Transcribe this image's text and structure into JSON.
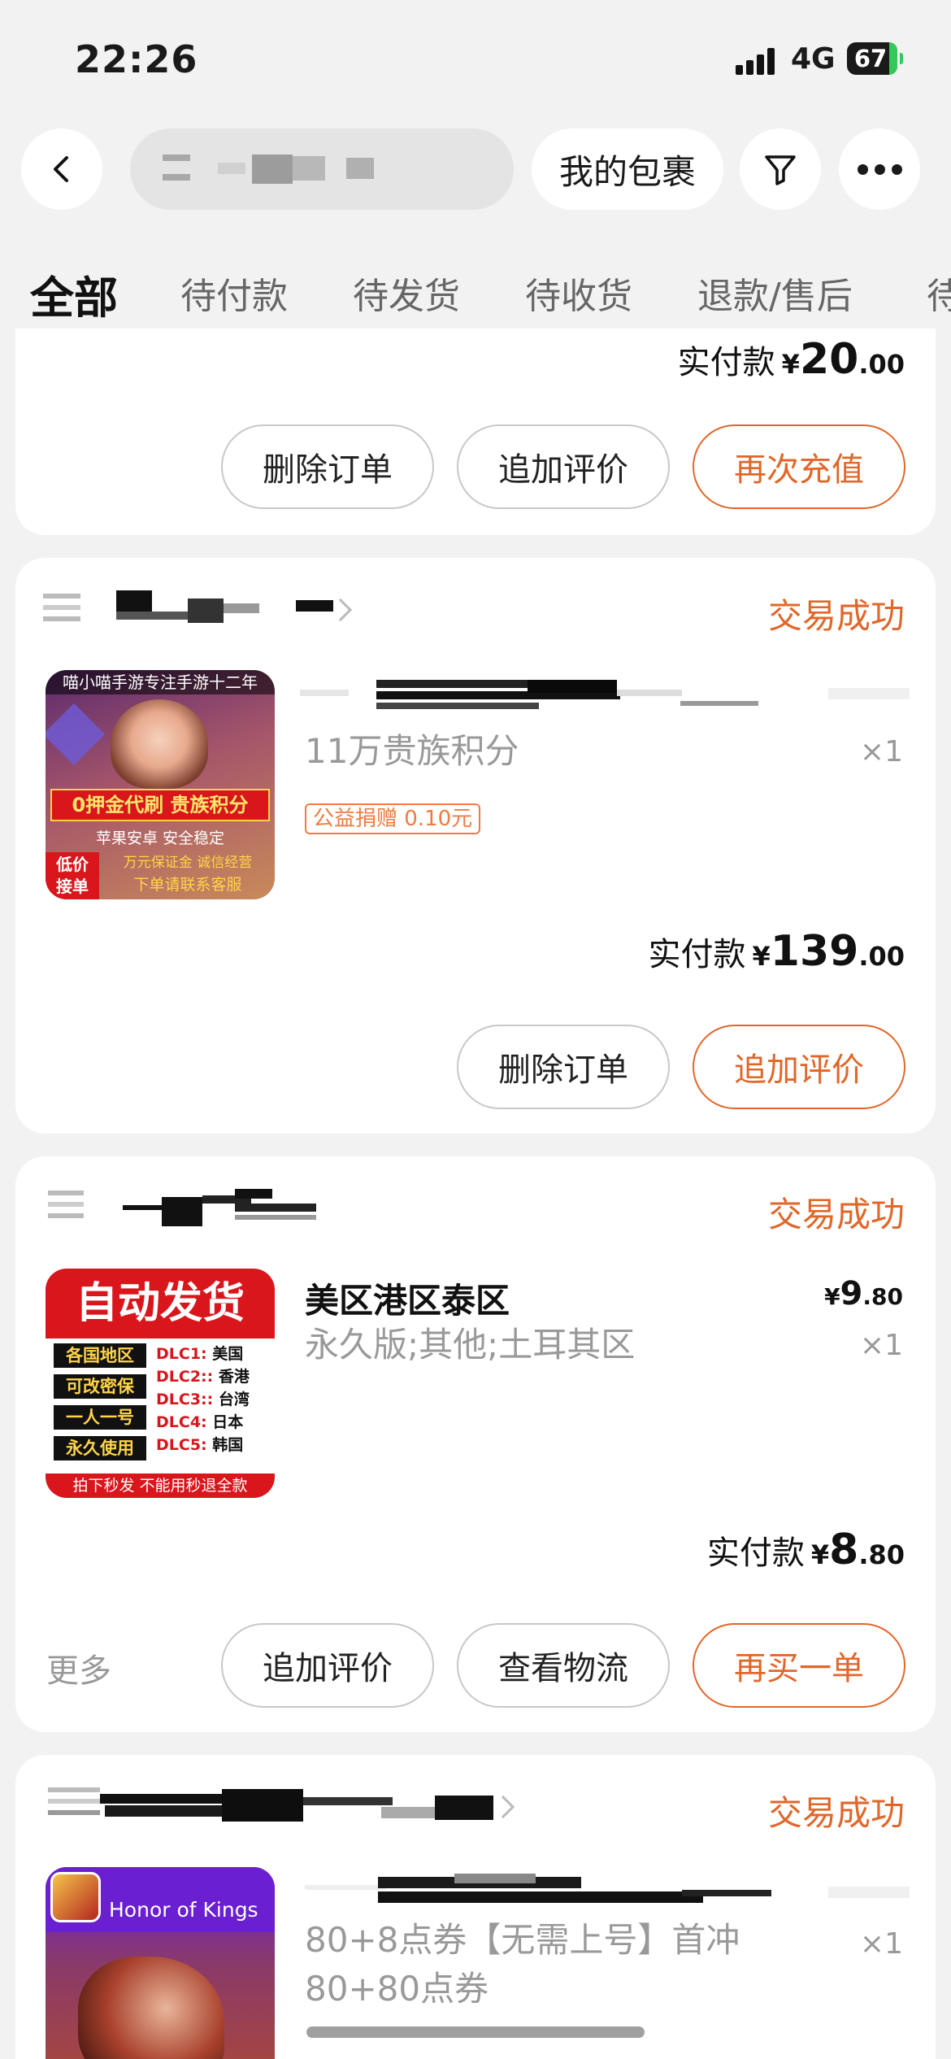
{
  "status_bar": {
    "time": "22:26",
    "network": "4G",
    "battery": "67"
  },
  "nav": {
    "package_label": "我的包裹"
  },
  "tabs": [
    {
      "label": "全部",
      "active": true
    },
    {
      "label": "待付款"
    },
    {
      "label": "待发货"
    },
    {
      "label": "待收货"
    },
    {
      "label": "退款/售后"
    },
    {
      "label": "待"
    }
  ],
  "orders": [
    {
      "paid_label": "实付款",
      "currency": "¥",
      "paid_int": "20",
      "paid_dec": ".00",
      "buttons": [
        "删除订单",
        "追加评价",
        "再次充值"
      ]
    },
    {
      "status": "交易成功",
      "thumb": {
        "banner": "喵小喵手游专注手游十二年",
        "slogan": "0押金代刷 贵族积分",
        "sub": "苹果安卓 安全稳定",
        "corner": "低价\n接单",
        "tags": "万元保证金  诚信经营",
        "foot": "下单请联系客服"
      },
      "spec": "11万贵族积分",
      "qty": "×1",
      "badge": "公益捐赠 0.10元",
      "paid_label": "实付款",
      "currency": "¥",
      "paid_int": "139",
      "paid_dec": ".00",
      "buttons": [
        "删除订单",
        "追加评价"
      ]
    },
    {
      "status": "交易成功",
      "thumb": {
        "head": "自动发货",
        "tags": [
          "各国地区",
          "可改密保",
          "一人一号",
          "永久使用"
        ],
        "dlc": [
          {
            "k": "DLC1:",
            "v": "美国"
          },
          {
            "k": "DLC2::",
            "v": "香港"
          },
          {
            "k": "DLC3::",
            "v": "台湾"
          },
          {
            "k": "DLC4:",
            "v": "日本"
          },
          {
            "k": "DLC5:",
            "v": "韩国"
          }
        ],
        "foot": "拍下秒发  不能用秒退全款"
      },
      "name": "美区港区泰区",
      "spec": "永久版;其他;土耳其区",
      "price_currency": "¥",
      "price_int": "9",
      "price_dec": ".80",
      "qty": "×1",
      "paid_label": "实付款",
      "currency": "¥",
      "paid_int": "8",
      "paid_dec": ".80",
      "more": "更多",
      "buttons": [
        "追加评价",
        "查看物流",
        "再买一单"
      ]
    },
    {
      "status": "交易成功",
      "thumb": {
        "label": "Honor of Kings"
      },
      "spec_line1": "80+8点券【无需上号】首冲",
      "spec_line2": "80+80点券",
      "qty": "×1"
    }
  ],
  "colors": {
    "accent": "#e0672a",
    "background": "#f2f2f2"
  },
  "icons": [
    "back-arrow-icon",
    "filter-icon",
    "more-dots-icon",
    "signal-icon",
    "battery-icon",
    "chevron-right-icon"
  ]
}
